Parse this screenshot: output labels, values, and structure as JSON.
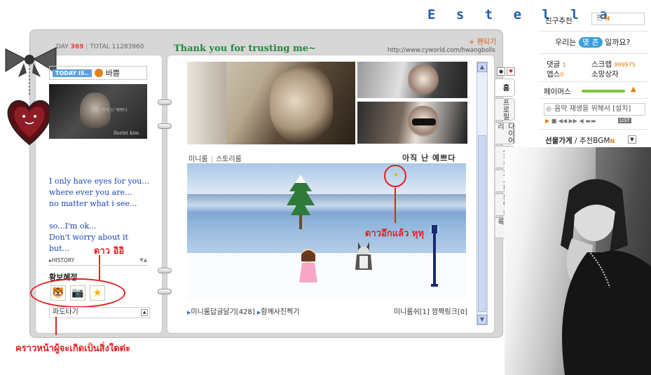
{
  "header": {
    "brand": "E s t e l l a"
  },
  "top": {
    "today_label": "DAY",
    "today_count": "369",
    "total_label": "TOTAL",
    "total_count": "11283960",
    "thanks": "Thank you for trusting me~",
    "fan_button": "+ 팬되기",
    "url": "http://www.cyworld.com/hwangbolls"
  },
  "left_panel": {
    "today_is_label": "TODAY IS..",
    "today_is_value": "바쁨",
    "photo_caption": "florist kim",
    "photo_text": "항상, 아직 난 예쁘다",
    "poem": [
      "I only have eyes for you...",
      "where ever you are...",
      "no matter what i see...",
      "so...I'm ok...",
      "Don't worry about it",
      "but..."
    ],
    "history_label": "HISTORY",
    "stars_heading": "황보혜정",
    "pan_label": "파도타기",
    "annotation_star": "ดาว อิอิ",
    "annotation_bottom": "คราวหน้าผู้จะเกิดเป็นสิ่งใดต่ะ"
  },
  "right_panel": {
    "mini_tabs": [
      "미니룸",
      "스토리룸"
    ],
    "mood_text": "아직 난 예쁘다",
    "annotation_star": "ดาวอึกแล้ว หุหุ",
    "bottom_left_1": "미니룸답글달기[428]",
    "bottom_left_2": "함께사진찍기",
    "bottom_right": "미니룸쉬[1] 깜짝링크[0]"
  },
  "vtabs": [
    "홈",
    "프로필",
    "다이어리",
    "사진첩",
    "게시판",
    "동영상",
    "방명록"
  ],
  "side": {
    "friend_label": "친구추천",
    "friend_input": "편",
    "question_pre": "우리는",
    "question_pill": "몇 촌",
    "question_post": "일까요?",
    "comments_label": "댓글",
    "comments_value": "1",
    "scrap_label": "스크랩",
    "scrap_value": "999975",
    "apps_label": "앱스",
    "apps_value": "0",
    "mailbox_label": "소망상자",
    "fame_label": "페이머스",
    "music_text": "음악 재생을 위해서 [설치]",
    "list_label": "LIST",
    "gift_label": "선물가게",
    "bgm_label": "추천BGM",
    "new_badge": "N"
  },
  "colors": {
    "accent_red": "#e32020",
    "brand_blue": "#1f5fa8",
    "thanks_green": "#218a3a",
    "orange": "#e57a00"
  }
}
